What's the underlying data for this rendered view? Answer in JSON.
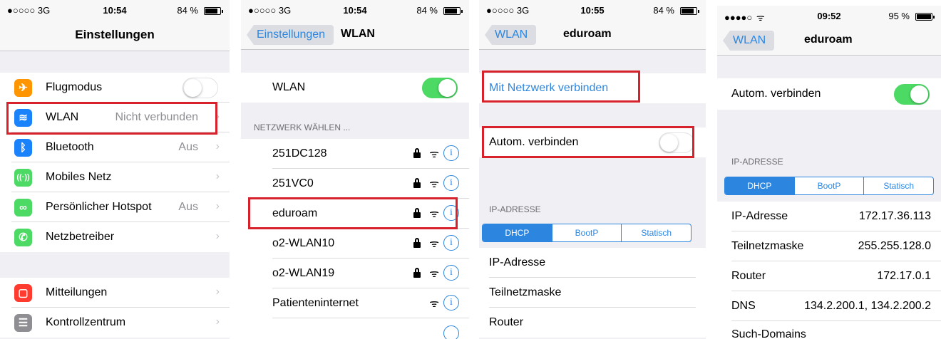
{
  "colors": {
    "accent": "#2c86e0",
    "toggle_on": "#4cd964",
    "highlight": "#d7212b"
  },
  "screen1": {
    "status": {
      "carrier": "●○○○○  3G",
      "time": "10:54",
      "battery": "84 %"
    },
    "title": "Einstellungen",
    "items": [
      {
        "label": "Flugmodus",
        "icon": "airplane-icon",
        "icon_color": "#ff9500",
        "toggle": "off"
      },
      {
        "label": "WLAN",
        "value": "Nicht verbunden",
        "icon": "wifi-icon",
        "icon_color": "#1a82fb"
      },
      {
        "label": "Bluetooth",
        "value": "Aus",
        "icon": "bluetooth-icon",
        "icon_color": "#1a82fb"
      },
      {
        "label": "Mobiles Netz",
        "icon": "antenna-icon",
        "icon_color": "#4cd964"
      },
      {
        "label": "Persönlicher Hotspot",
        "value": "Aus",
        "icon": "hotspot-icon",
        "icon_color": "#4cd964"
      },
      {
        "label": "Netzbetreiber",
        "icon": "phone-icon",
        "icon_color": "#4cd964"
      },
      {
        "label": "Mitteilungen",
        "icon": "notifications-icon",
        "icon_color": "#ff3b30"
      },
      {
        "label": "Kontrollzentrum",
        "icon": "control-center-icon",
        "icon_color": "#8e8e93"
      }
    ]
  },
  "screen2": {
    "status": {
      "carrier": "●○○○○  3G",
      "time": "10:54",
      "battery": "84 %"
    },
    "back": "Einstellungen",
    "title": "WLAN",
    "wlan_label": "WLAN",
    "wlan_toggle": "on",
    "section": "NETZWERK WÄHLEN ...",
    "networks": [
      {
        "name": "251DC128",
        "locked": true
      },
      {
        "name": "251VC0",
        "locked": true
      },
      {
        "name": "eduroam",
        "locked": true
      },
      {
        "name": "o2-WLAN10",
        "locked": true
      },
      {
        "name": "o2-WLAN19",
        "locked": true
      },
      {
        "name": "Patienteninternet",
        "locked": false
      }
    ]
  },
  "screen3": {
    "status": {
      "carrier": "●○○○○  3G",
      "time": "10:55",
      "battery": "84 %"
    },
    "back": "WLAN",
    "title": "eduroam",
    "connect": "Mit Netzwerk verbinden",
    "auto": "Autom. verbinden",
    "auto_toggle": "off",
    "section": "IP-ADRESSE",
    "segments": [
      "DHCP",
      "BootP",
      "Statisch"
    ],
    "selected_segment": "DHCP",
    "rows": [
      "IP-Adresse",
      "Teilnetzmaske",
      "Router"
    ]
  },
  "screen4": {
    "status": {
      "carrier": "●●●●○  ",
      "time": "09:52",
      "battery": "95 %"
    },
    "back": "WLAN",
    "title": "eduroam",
    "auto": "Autom. verbinden",
    "auto_toggle": "on",
    "section": "IP-ADRESSE",
    "segments": [
      "DHCP",
      "BootP",
      "Statisch"
    ],
    "selected_segment": "DHCP",
    "rows": [
      {
        "label": "IP-Adresse",
        "value": "172.17.36.113"
      },
      {
        "label": "Teilnetzmaske",
        "value": "255.255.128.0"
      },
      {
        "label": "Router",
        "value": "172.17.0.1"
      },
      {
        "label": "DNS",
        "value": "134.2.200.1, 134.2.200.2"
      },
      {
        "label": "Such-Domains"
      }
    ]
  }
}
